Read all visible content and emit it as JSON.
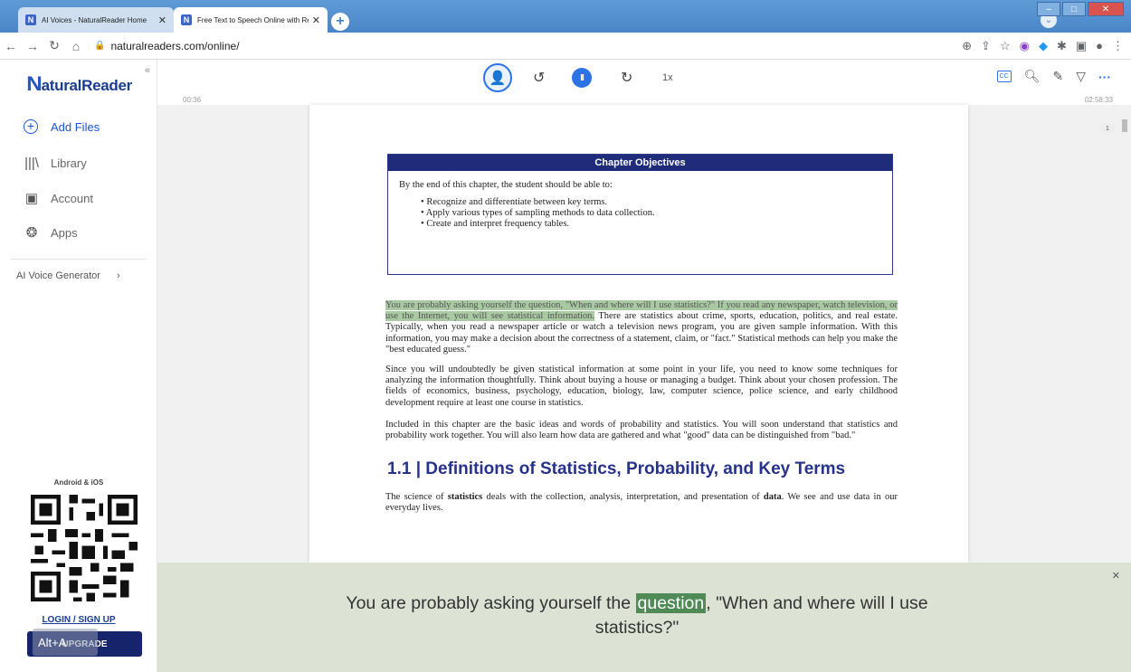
{
  "browser": {
    "tabs": [
      {
        "title": "AI Voices - NaturalReader Home",
        "active": false
      },
      {
        "title": "Free Text to Speech Online with Realisti",
        "active": true
      }
    ],
    "url": "naturalreaders.com/online/"
  },
  "app": {
    "logo": "aturalReader",
    "logo_n": "N",
    "nav": [
      {
        "label": "Add Files",
        "icon": "add-circle-icon"
      },
      {
        "label": "Library",
        "icon": "library-icon"
      },
      {
        "label": "Account",
        "icon": "account-icon"
      },
      {
        "label": "Apps",
        "icon": "apps-icon"
      }
    ],
    "ai_voice": "AI Voice Generator",
    "android_ios": "Android & iOS",
    "login": "LOGIN / SIGN UP",
    "upgrade": "UPGRADE",
    "alt_badge": "Alt+A"
  },
  "player": {
    "elapsed": "00:36",
    "total": "02:58:33",
    "speed": "1x",
    "cc": "CC"
  },
  "document": {
    "page_number": "1",
    "objectives_title": "Chapter Objectives",
    "objectives_intro": "By the end of this chapter, the student should be able to:",
    "objectives": [
      "Recognize and differentiate between key terms.",
      "Apply various types of sampling methods to data collection.",
      "Create and interpret frequency tables."
    ],
    "para1_highlighted": "You are probably asking yourself the question, \"When and where will I use statistics?\" If you read any newspaper, watch television, or use the Internet, you will see statistical information.",
    "para1_rest": " There are statistics about crime, sports, education, politics, and real estate. Typically, when you read a newspaper article or watch a television news program, you are given sample information. With this information, you may make a decision about the correctness of a statement, claim, or \"fact.\" Statistical methods can help you make the \"best educated guess.\"",
    "para2": "Since you will undoubtedly be given statistical information at some point in your life, you need to know some techniques for analyzing the information thoughtfully. Think about buying a house or managing a budget. Think about your chosen profession. The fields of economics, business, psychology, education, biology, law, computer science, police science, and early childhood development require at least one course in statistics.",
    "para3": "Included in this chapter are the basic ideas and words of probability and statistics. You will soon understand that statistics and probability work together. You will also learn how data are gathered and what \"good\" data can be distinguished from \"bad.\"",
    "heading": "1.1 | Definitions of Statistics, Probability, and Key Terms",
    "para4_a": "The science of ",
    "para4_b": "statistics",
    "para4_c": " deals with the collection, analysis, interpretation, and presentation of ",
    "para4_d": "data",
    "para4_e": ". We see and use data in our everyday lives."
  },
  "caption": {
    "before": "You are probably asking yourself the ",
    "highlight": "question",
    "after": ", \"When and where will I use statistics?\""
  }
}
